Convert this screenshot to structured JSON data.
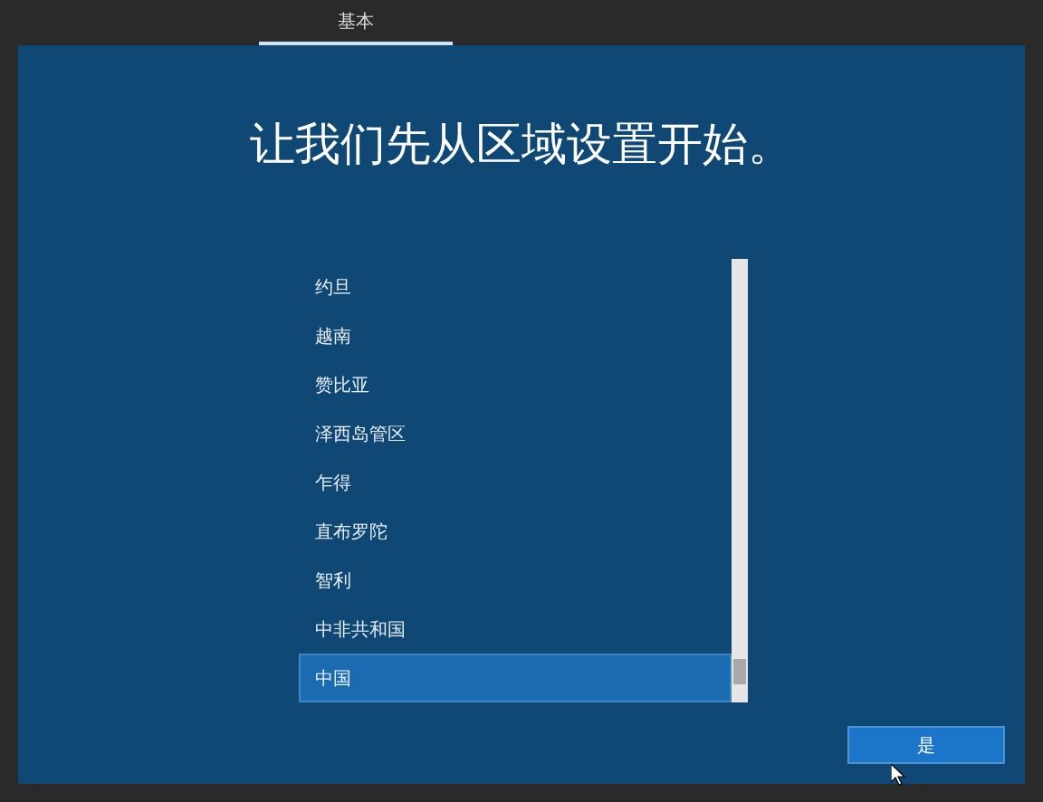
{
  "tabs": [
    {
      "label": "基本",
      "selected": true
    }
  ],
  "title": "让我们先从区域设置开始。",
  "regions": [
    {
      "label": "约旦",
      "selected": false
    },
    {
      "label": "越南",
      "selected": false
    },
    {
      "label": "赞比亚",
      "selected": false
    },
    {
      "label": "泽西岛管区",
      "selected": false
    },
    {
      "label": "乍得",
      "selected": false
    },
    {
      "label": "直布罗陀",
      "selected": false
    },
    {
      "label": "智利",
      "selected": false
    },
    {
      "label": "中非共和国",
      "selected": false
    },
    {
      "label": "中国",
      "selected": true
    }
  ],
  "button": "是"
}
